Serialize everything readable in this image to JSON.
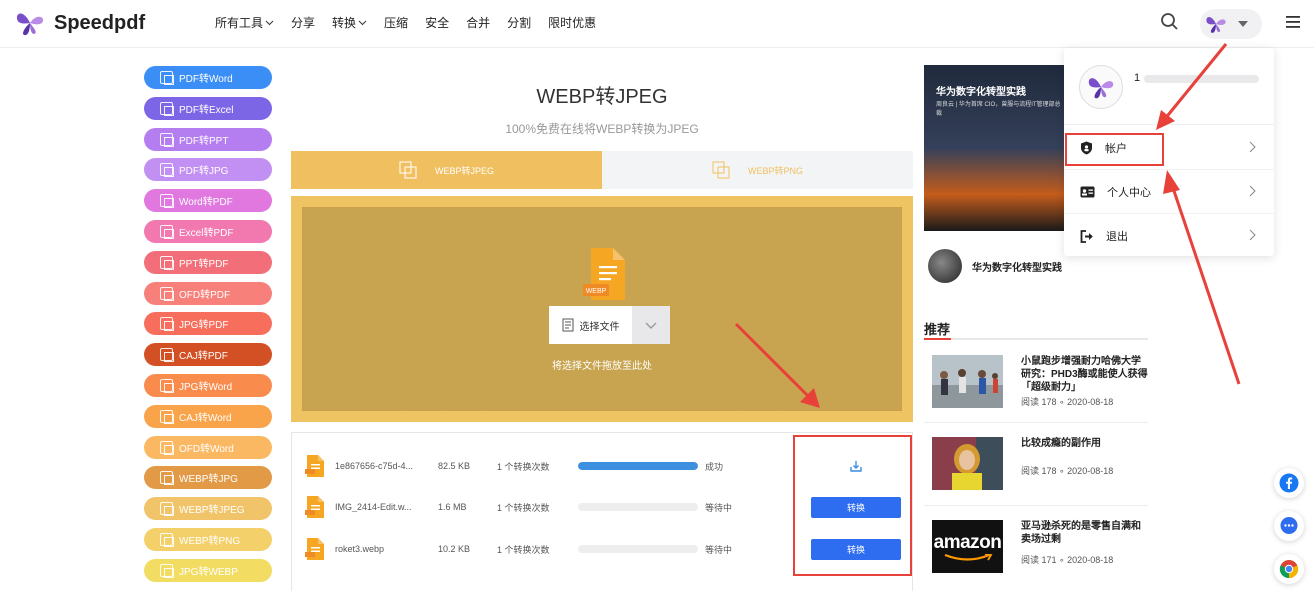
{
  "header": {
    "logo_text": "Speedpdf",
    "nav": [
      {
        "label": "所有工具",
        "has_dropdown": true
      },
      {
        "label": "分享",
        "has_dropdown": false
      },
      {
        "label": "转换",
        "has_dropdown": true
      },
      {
        "label": "压缩",
        "has_dropdown": false
      },
      {
        "label": "安全",
        "has_dropdown": false
      },
      {
        "label": "合并",
        "has_dropdown": false
      },
      {
        "label": "分割",
        "has_dropdown": false
      },
      {
        "label": "限时优惠",
        "has_dropdown": false
      }
    ]
  },
  "sidebar": {
    "items": [
      {
        "label": "PDF转Word",
        "color": "#3a8ef5"
      },
      {
        "label": "PDF转Excel",
        "color": "#7d66e6"
      },
      {
        "label": "PDF转PPT",
        "color": "#b47ef0"
      },
      {
        "label": "PDF转JPG",
        "color": "#c28ff2"
      },
      {
        "label": "Word转PDF",
        "color": "#e078e0"
      },
      {
        "label": "Excel转PDF",
        "color": "#f278b0"
      },
      {
        "label": "PPT转PDF",
        "color": "#f26e78"
      },
      {
        "label": "OFD转PDF",
        "color": "#f7807a"
      },
      {
        "label": "JPG转PDF",
        "color": "#f76e5c"
      },
      {
        "label": "CAJ转PDF",
        "color": "#d34f24"
      },
      {
        "label": "JPG转Word",
        "color": "#f98c4c"
      },
      {
        "label": "CAJ转Word",
        "color": "#f9a44a"
      },
      {
        "label": "OFD转Word",
        "color": "#fbb862"
      },
      {
        "label": "WEBP转JPG",
        "color": "#e29a46"
      },
      {
        "label": "WEBP转JPEG",
        "color": "#f2c46a"
      },
      {
        "label": "WEBP转PNG",
        "color": "#f4d06a"
      },
      {
        "label": "JPG转WEBP",
        "color": "#f2dc62"
      }
    ]
  },
  "main": {
    "title": "WEBP转JPEG",
    "subtitle": "100%免费在线将WEBP转换为JPEG",
    "tabs": [
      {
        "label": "WEBP转JPEG",
        "active": true
      },
      {
        "label": "WEBP转PNG",
        "active": false
      }
    ],
    "upload": {
      "file_badge": "WEBP",
      "select_label": "选择文件",
      "drop_hint": "将选择文件拖放至此处"
    },
    "files": [
      {
        "name": "1e867656-c75d-4...",
        "size": "82.5 KB",
        "count": "1 个转换次数",
        "progress": 1.0,
        "status": "成功",
        "action": "download"
      },
      {
        "name": "IMG_2414-Edit.w...",
        "size": "1.6 MB",
        "count": "1 个转换次数",
        "progress": 0,
        "status": "等待中",
        "action": "转换"
      },
      {
        "name": "roket3.webp",
        "size": "10.2 KB",
        "count": "1 个转换次数",
        "progress": 0,
        "status": "等待中",
        "action": "转换"
      }
    ]
  },
  "right": {
    "book_cover_title": "华为数字化转型实践",
    "book_cover_sub": "周良云 | 华为首席 CIO，曾服与流程IT管理部总裁",
    "book_name": "华为数字化转型实践",
    "rec_heading": "推荐",
    "recommendations": [
      {
        "title": "小鼠跑步增强耐力哈佛大学研究：PHD3酶或能使人获得「超级耐力」",
        "reads": "阅读 178",
        "date": "2020-08-18"
      },
      {
        "title": "比较成瘾的副作用",
        "reads": "阅读 178",
        "date": "2020-08-18"
      },
      {
        "title": "亚马逊杀死的是零售自满和卖场过剩",
        "reads": "阅读 171",
        "date": "2020-08-18"
      }
    ],
    "amazon_logo": "amazon"
  },
  "dropdown": {
    "name": "1",
    "items": [
      {
        "label": "帐户",
        "icon": "shield-icon"
      },
      {
        "label": "个人中心",
        "icon": "id-card-icon"
      },
      {
        "label": "退出",
        "icon": "logout-icon"
      }
    ]
  },
  "float_buttons": [
    {
      "icon": "facebook-icon",
      "color": "#1877f2"
    },
    {
      "icon": "chat-icon",
      "color": "#2e6cf0"
    },
    {
      "icon": "chrome-icon",
      "color": "#db4437"
    }
  ]
}
